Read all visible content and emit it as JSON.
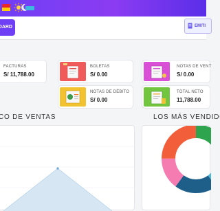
{
  "header": {
    "icons": [
      "flag-icon",
      "sun-icon",
      "moon-icon",
      "toggle-icon"
    ]
  },
  "toolbar": {
    "dashboard_label": "OARD",
    "emit_label": "EMITI"
  },
  "cards": [
    {
      "label": "FACTURAS",
      "value": "S/ 11,788.00",
      "thumb_color": "#f05a5a"
    },
    {
      "label": "BOLETAS",
      "value": "S/ 0.00",
      "thumb_color": "#ef5f5f"
    },
    {
      "label": "NOTAS DE VENT",
      "value": "S/ 0.00",
      "thumb_color": "#d94fd6"
    },
    {
      "label": "NOTAS DE DÉBITO",
      "value": "S/ 0.00",
      "thumb_color": "#f2c230"
    },
    {
      "label": "TOTAL NETO",
      "value": "11,788.00",
      "thumb_color": "#72c63f"
    }
  ],
  "sections": {
    "sales_chart_title": "CO DE VENTAS",
    "top_sold_title": "LOS MÁS VENDIDO"
  },
  "colors": {
    "accent": "#6f3ff5",
    "area_fill": "#d6e7f3",
    "donut": [
      "#2ea44f",
      "#4dbad3",
      "#1e5f8a",
      "#f47cb0",
      "#f25e3a"
    ]
  }
}
